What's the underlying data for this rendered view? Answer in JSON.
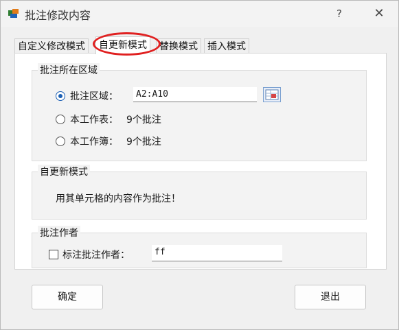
{
  "window": {
    "title": "批注修改内容",
    "help": "?",
    "close": "✕"
  },
  "tabs": [
    {
      "label": "自定义修改模式",
      "active": false
    },
    {
      "label": "自更新模式",
      "active": true
    },
    {
      "label": "替换模式",
      "active": false
    },
    {
      "label": "插入模式",
      "active": false
    }
  ],
  "range_group": {
    "title": "批注所在区域",
    "options": [
      {
        "label": "批注区域：",
        "value": "A2:A10",
        "selected": true
      },
      {
        "label": "本工作表：",
        "value": "9个批注",
        "selected": false
      },
      {
        "label": "本工作簿：",
        "value": "9个批注",
        "selected": false
      }
    ]
  },
  "mode_group": {
    "title": "自更新模式",
    "description": "用其单元格的内容作为批注！"
  },
  "author_group": {
    "title": "批注作者",
    "checkbox_label": "标注批注作者：",
    "checked": false,
    "author_value": "ff"
  },
  "buttons": {
    "ok": "确定",
    "exit": "退出"
  },
  "colors": {
    "accent": "#1a5fb4",
    "highlight": "#e02020"
  }
}
